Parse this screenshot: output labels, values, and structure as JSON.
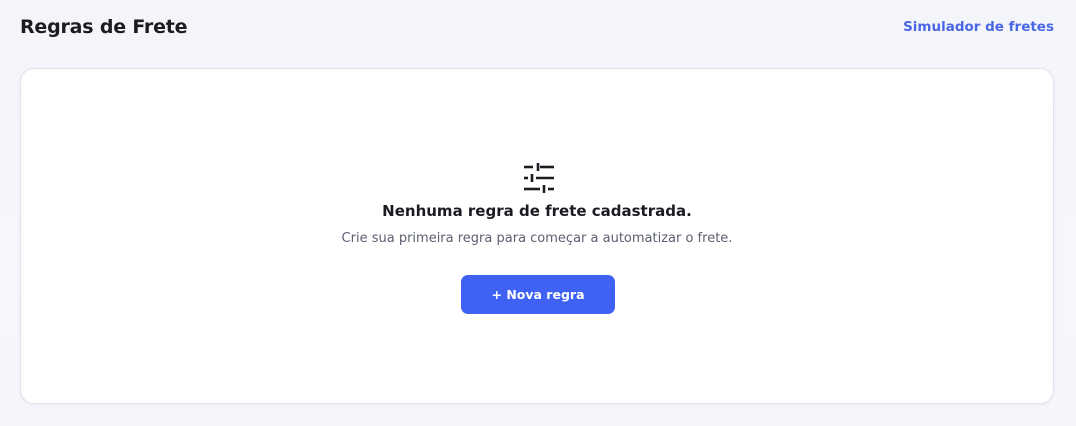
{
  "header": {
    "title": "Regras de Frete",
    "simulator_link": "Simulador de fretes"
  },
  "empty_state": {
    "icon": "sliders-icon",
    "title": "Nenhuma regra de frete cadastrada.",
    "description": "Crie sua primeira regra para começar a automatizar o frete.",
    "button_label": "+ Nova regra"
  },
  "colors": {
    "accent": "#3f62f5",
    "link": "#4a67e6",
    "text_primary": "#1b1c22",
    "text_secondary": "#5c6072"
  }
}
